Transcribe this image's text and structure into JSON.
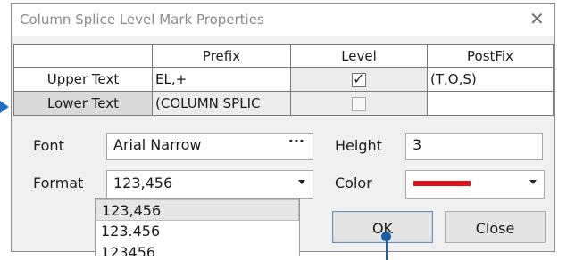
{
  "dialog": {
    "title": "Column Splice Level Mark Properties"
  },
  "grid": {
    "columns": [
      "Prefix",
      "Level",
      "PostFix"
    ],
    "rows": [
      {
        "label": "Upper Text",
        "prefix": "EL,+",
        "level_checked": true,
        "postfix": "(T,O,S)"
      },
      {
        "label": "Lower Text",
        "prefix": "(COLUMN SPLIC",
        "level_checked": false,
        "postfix": ""
      }
    ]
  },
  "font": {
    "label": "Font",
    "value": "Arial Narrow",
    "browse": "···"
  },
  "height": {
    "label": "Height",
    "value": "3"
  },
  "format": {
    "label": "Format",
    "value": "123,456",
    "options": [
      "123,456",
      "123.456",
      "123456"
    ],
    "selected_index": 0
  },
  "color": {
    "label": "Color",
    "swatch": "#e8101a"
  },
  "buttons": {
    "ok": "OK",
    "close": "Close"
  },
  "icons": {
    "close": "close-icon",
    "checkmark": "checkmark-icon",
    "dropdown": "chevron-down-icon"
  },
  "colors": {
    "pointer": "#1c5fa5"
  }
}
